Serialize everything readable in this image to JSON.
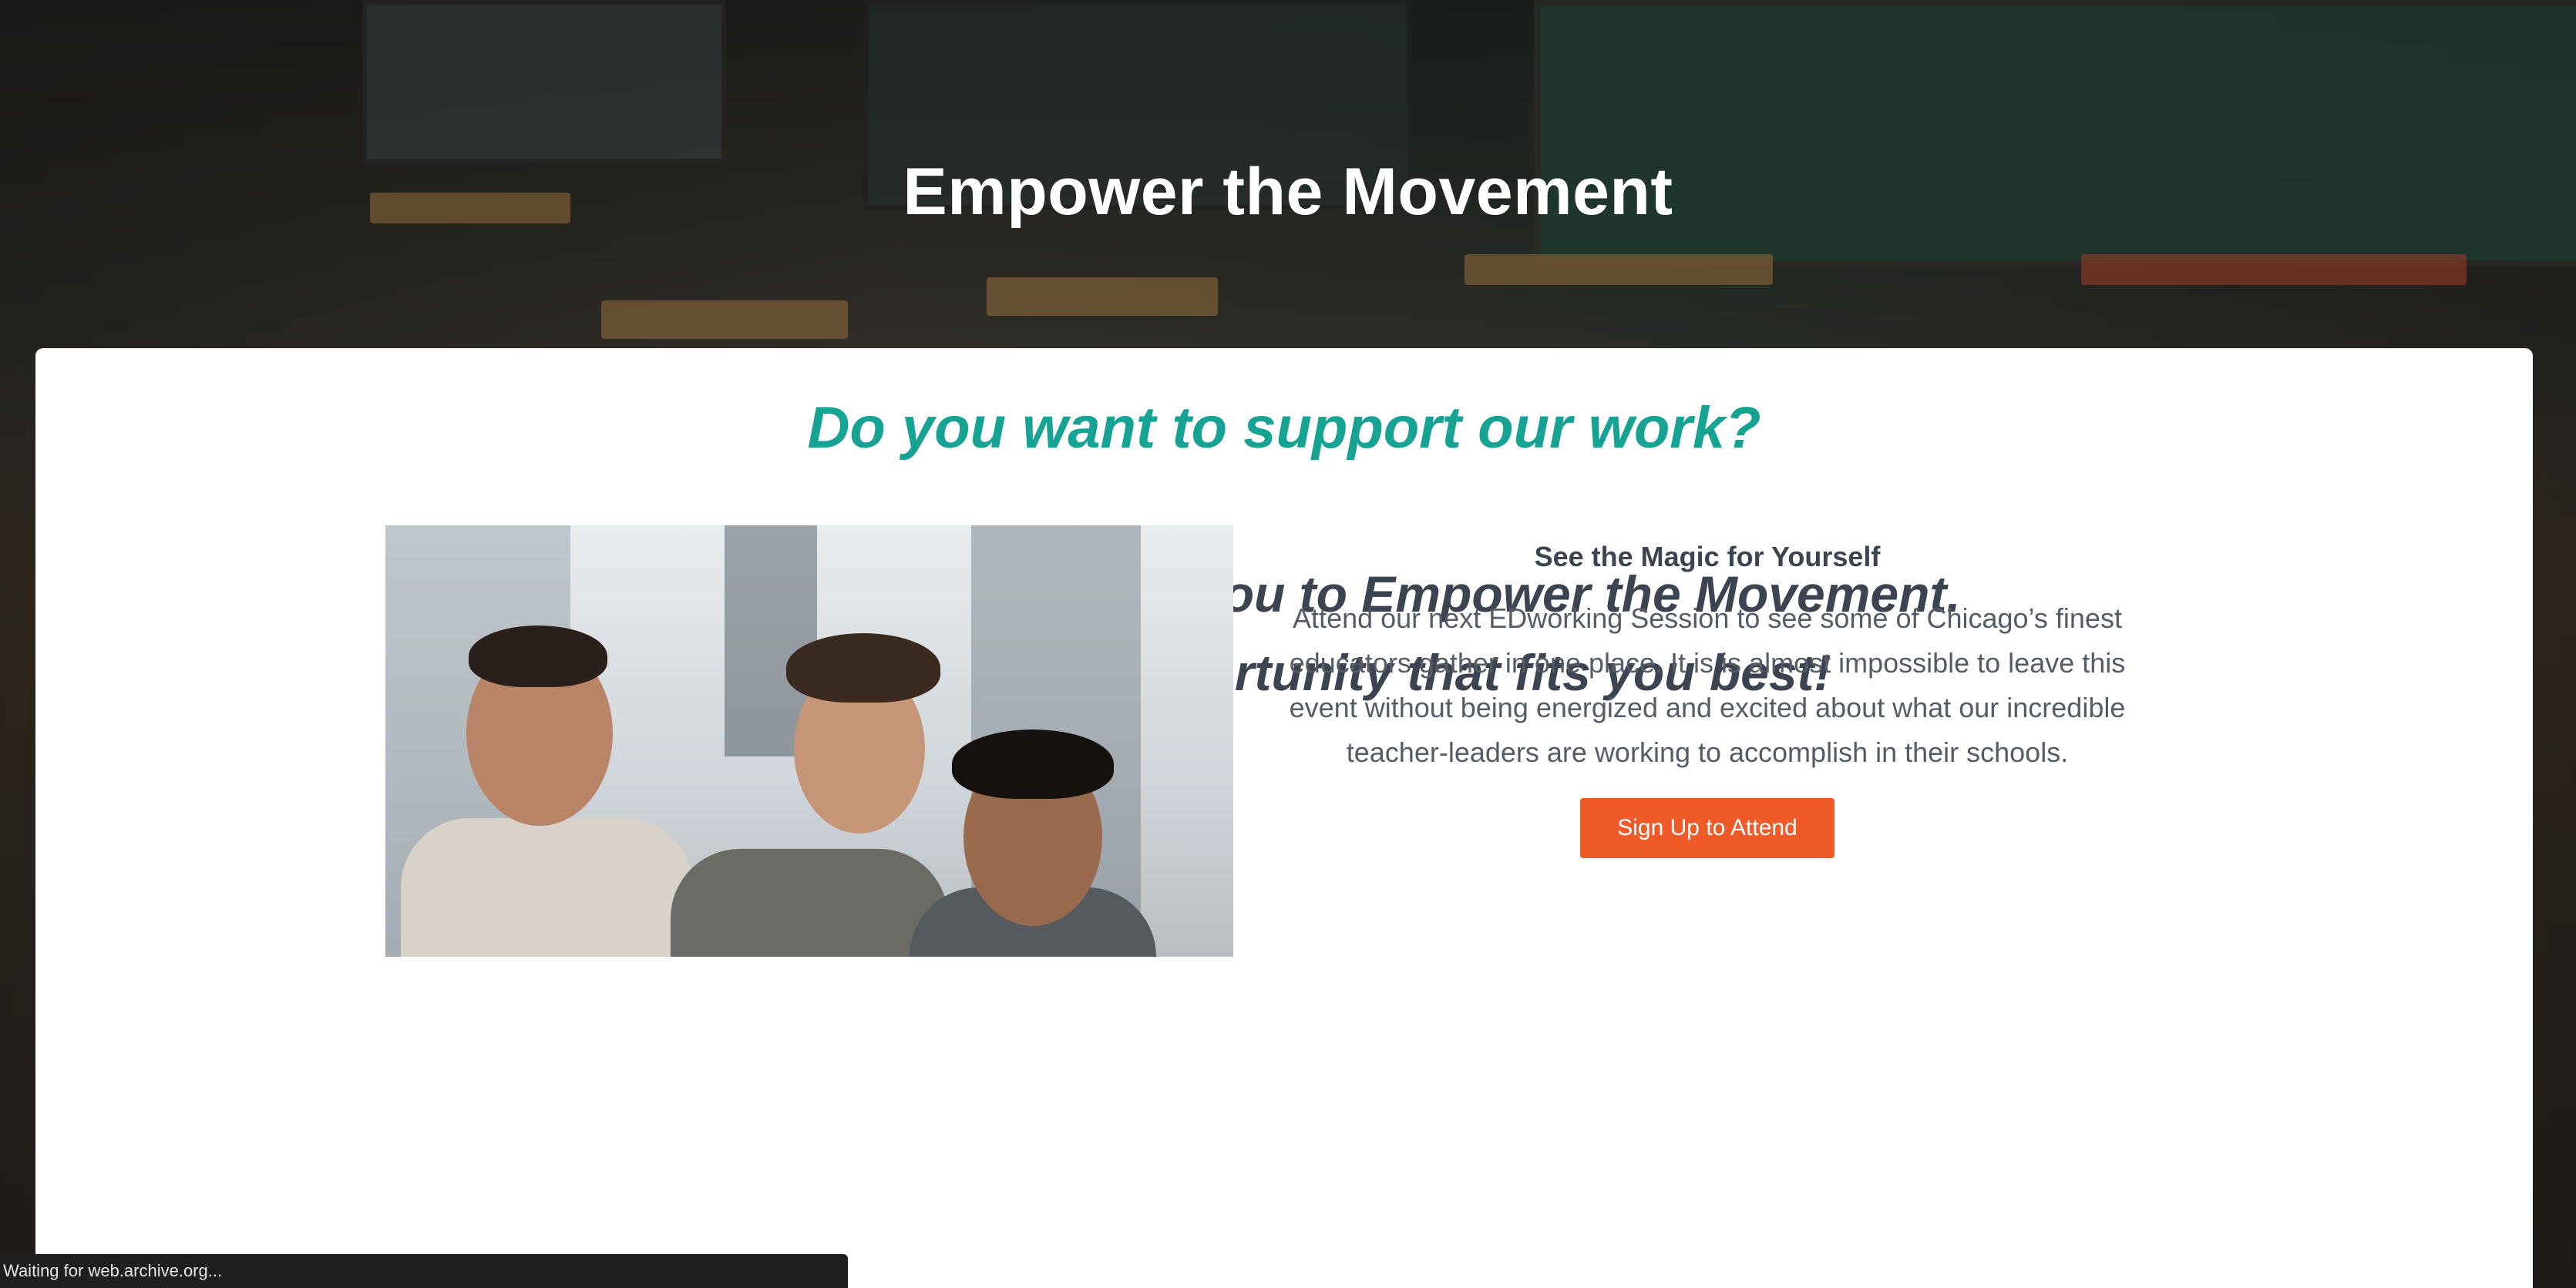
{
  "hero": {
    "title": "Empower the Movement"
  },
  "card": {
    "heading": "Do you want to support our work?",
    "ways_line1": "We have many ways for you to Empower the Movement.",
    "ways_line2": "Please find the opportunity that fits you best!"
  },
  "magic": {
    "title": "See the Magic for Yourself",
    "body": "Attend our next EDworking Session to see some of Chicago’s finest educators gather in one place. It is is almost impossible to leave this event without being energized and excited about what our incredible teacher-leaders are working to accomplish in their schools.",
    "button_label": "Sign Up to Attend"
  },
  "status_bar": {
    "text": "Waiting for web.archive.org..."
  },
  "colors": {
    "accent_teal": "#16a394",
    "button_orange": "#ee5a28",
    "heading_dark": "#3c4452"
  }
}
